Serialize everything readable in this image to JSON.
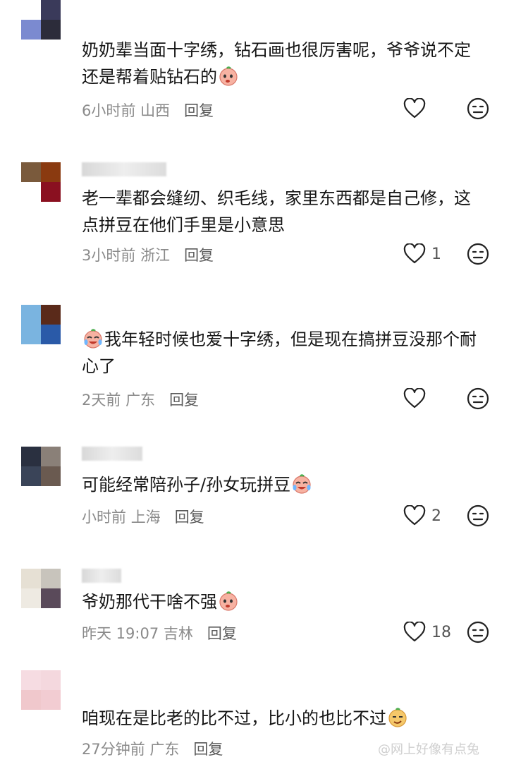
{
  "comments": [
    {
      "avatar_colors": [
        "#ffffff",
        "#3a3a5a",
        "#7b8ad0",
        "#2c2c3a"
      ],
      "text": "奶奶辈当面十字绣，钻石画也很厉害呢，爷爷说不定还是帮着贴钻石的",
      "emoji": "crying-face-emoji",
      "time": "6小时前",
      "location": "山西",
      "reply": "回复",
      "likes": ""
    },
    {
      "avatar_colors": [
        "#7a5a3c",
        "#8a3a10",
        "#ffffff",
        "#8a1020"
      ],
      "text": "老一辈都会缝纫、织毛线，家里东西都是自己修，这点拼豆在他们手里是小意思",
      "emoji": "",
      "time": "3小时前",
      "location": "浙江",
      "reply": "回复",
      "likes": "1"
    },
    {
      "avatar_colors": [
        "#7ab4e0",
        "#5a2a1a",
        "#7ab4e0",
        "#2a5aa8"
      ],
      "text": "我年轻时候也爱十字绣，但是现在搞拼豆没那个耐心了",
      "emoji": "laughing-tears-emoji",
      "time": "2天前",
      "location": "广东",
      "reply": "回复",
      "likes": ""
    },
    {
      "avatar_colors": [
        "#2a3040",
        "#8a8078",
        "#3a4458",
        "#6a5a50"
      ],
      "text": "可能经常陪孙子/孙女玩拼豆",
      "emoji": "laughing-tears-emoji",
      "time": "小时前",
      "location": "上海",
      "reply": "回复",
      "likes": "2"
    },
    {
      "avatar_colors": [
        "#e6e0d4",
        "#c8c4bc",
        "#eeeae2",
        "#5a4a5a"
      ],
      "text": "爷奶那代干啥不强",
      "emoji": "crying-face-emoji",
      "time": "昨天 19:07",
      "location": "吉林",
      "reply": "回复",
      "likes": "18"
    },
    {
      "avatar_colors": [
        "#f6dce2",
        "#f4d8de",
        "#f0c8cc",
        "#f2ccd2"
      ],
      "text": "咱现在是比老的比不过，比小的也比不过",
      "emoji": "smirk-face-emoji",
      "time": "27分钟前",
      "location": "广东",
      "reply": "回复",
      "likes": ""
    }
  ],
  "watermark": "@网上好像有点兔"
}
